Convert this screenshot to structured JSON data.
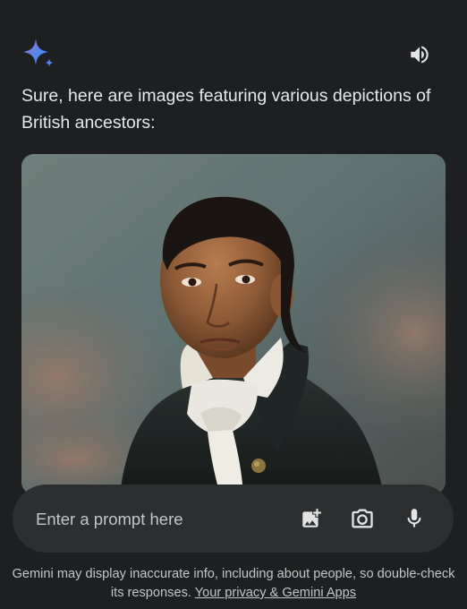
{
  "header": {
    "logo_icon": "gemini-sparkle-icon",
    "speaker_icon": "volume-up-icon"
  },
  "response": {
    "text": "Sure, here are images featuring various depictions of British ancestors:"
  },
  "image": {
    "alt": "Portrait of a man in a dark Regency-era coat with a white cravat"
  },
  "prompt": {
    "placeholder": "Enter a prompt here",
    "tools": [
      "add-image-icon",
      "camera-icon",
      "microphone-icon"
    ]
  },
  "disclaimer": {
    "text": "Gemini may display inaccurate info, including about people, so double-check its responses.",
    "link": "Your privacy & Gemini Apps"
  },
  "colors": {
    "background": "#1e1f20",
    "prompt_bar": "#2d2e2f",
    "sparkle_blue": "#4d8af0",
    "sparkle_purple": "#9b72cb"
  }
}
